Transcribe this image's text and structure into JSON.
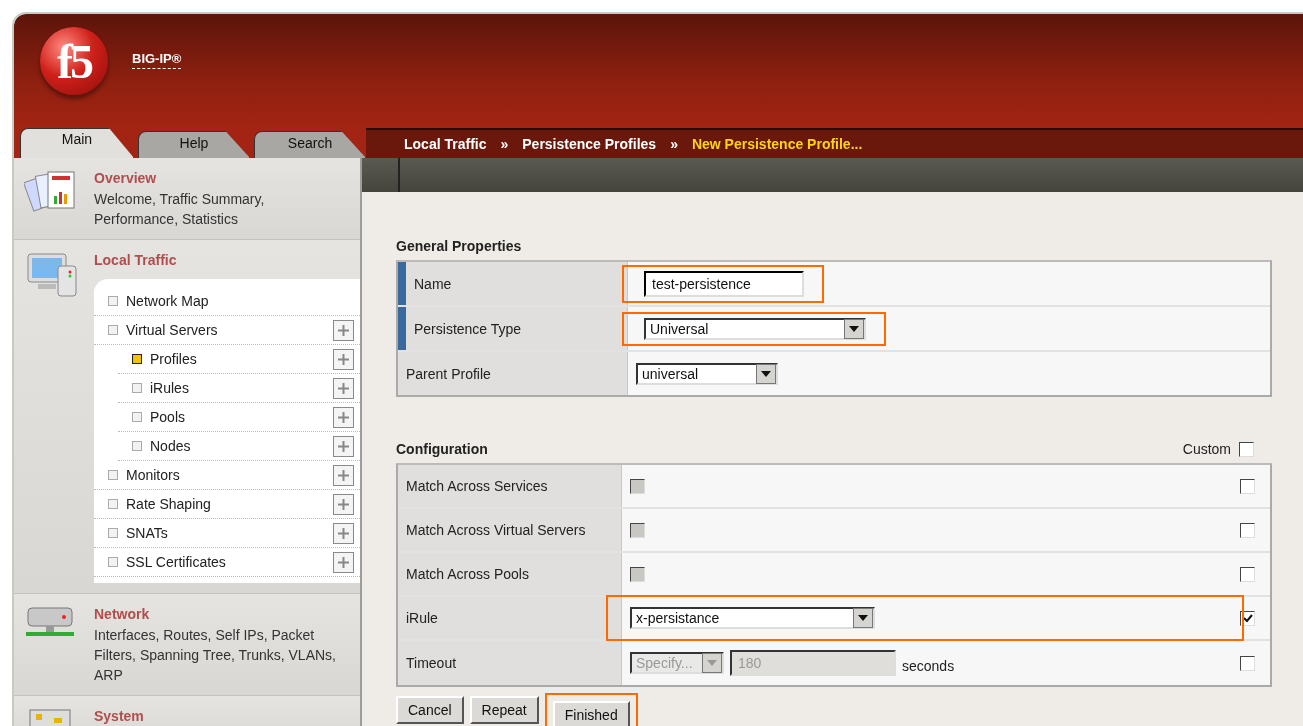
{
  "brand": {
    "logo": "f5",
    "product": "BIG-IP®"
  },
  "tabs": [
    {
      "label": "Main",
      "selected": true
    },
    {
      "label": "Help",
      "selected": false
    },
    {
      "label": "Search",
      "selected": false
    }
  ],
  "breadcrumb": {
    "items": [
      {
        "label": "Local Traffic",
        "current": false
      },
      {
        "label": "Persistence Profiles",
        "current": false
      },
      {
        "label": "New Persistence Profile...",
        "current": true
      }
    ],
    "separators": [
      "»",
      "»"
    ]
  },
  "sidebar": {
    "sections": [
      {
        "kind": "overview",
        "title": "Overview",
        "description": "Welcome, Traffic Summary, Performance, Statistics"
      },
      {
        "kind": "local",
        "title": "Local Traffic",
        "items": [
          {
            "label": "Network Map",
            "selected": false,
            "add": false
          },
          {
            "label": "Virtual Servers",
            "selected": false,
            "add": true,
            "children": [
              {
                "label": "Profiles",
                "selected": true,
                "add": true
              },
              {
                "label": "iRules",
                "selected": false,
                "add": true
              },
              {
                "label": "Pools",
                "selected": false,
                "add": true
              },
              {
                "label": "Nodes",
                "selected": false,
                "add": true
              }
            ]
          },
          {
            "label": "Monitors",
            "selected": false,
            "add": true
          },
          {
            "label": "Rate Shaping",
            "selected": false,
            "add": true
          },
          {
            "label": "SNATs",
            "selected": false,
            "add": true
          },
          {
            "label": "SSL Certificates",
            "selected": false,
            "add": true
          }
        ]
      },
      {
        "kind": "network",
        "title": "Network",
        "description": "Interfaces, Routes, Self IPs, Packet Filters, Spanning Tree, Trunks, VLANs, ARP"
      },
      {
        "kind": "system",
        "title": "System"
      }
    ]
  },
  "general": {
    "title": "General Properties",
    "rows": [
      {
        "label": "Name",
        "required": true,
        "kind": "text",
        "value": "test-persistence",
        "highlighted": true
      },
      {
        "label": "Persistence Type",
        "required": true,
        "kind": "select",
        "value": "Universal",
        "highlighted": true
      },
      {
        "label": "Parent Profile",
        "required": false,
        "kind": "select",
        "value": "universal",
        "highlighted": false
      }
    ]
  },
  "configuration": {
    "title": "Configuration",
    "custom_label": "Custom",
    "custom_checked": false,
    "rows": [
      {
        "label": "Match Across Services",
        "kind": "checkbox",
        "checked": false,
        "disabled": true,
        "custom": false,
        "highlighted": false
      },
      {
        "label": "Match Across Virtual Servers",
        "kind": "checkbox",
        "checked": false,
        "disabled": true,
        "custom": false,
        "highlighted": false
      },
      {
        "label": "Match Across Pools",
        "kind": "checkbox",
        "checked": false,
        "disabled": true,
        "custom": false,
        "highlighted": false
      },
      {
        "label": "iRule",
        "kind": "select",
        "value": "x-persistance",
        "disabled": false,
        "custom": true,
        "highlighted": true
      },
      {
        "label": "Timeout",
        "kind": "timeout",
        "mode": "Specify...",
        "value": "180",
        "unit": "seconds",
        "disabled": true,
        "custom": false,
        "highlighted": false
      }
    ]
  },
  "buttons": [
    {
      "label": "Cancel",
      "highlighted": false
    },
    {
      "label": "Repeat",
      "highlighted": false
    },
    {
      "label": "Finished",
      "highlighted": true
    }
  ]
}
